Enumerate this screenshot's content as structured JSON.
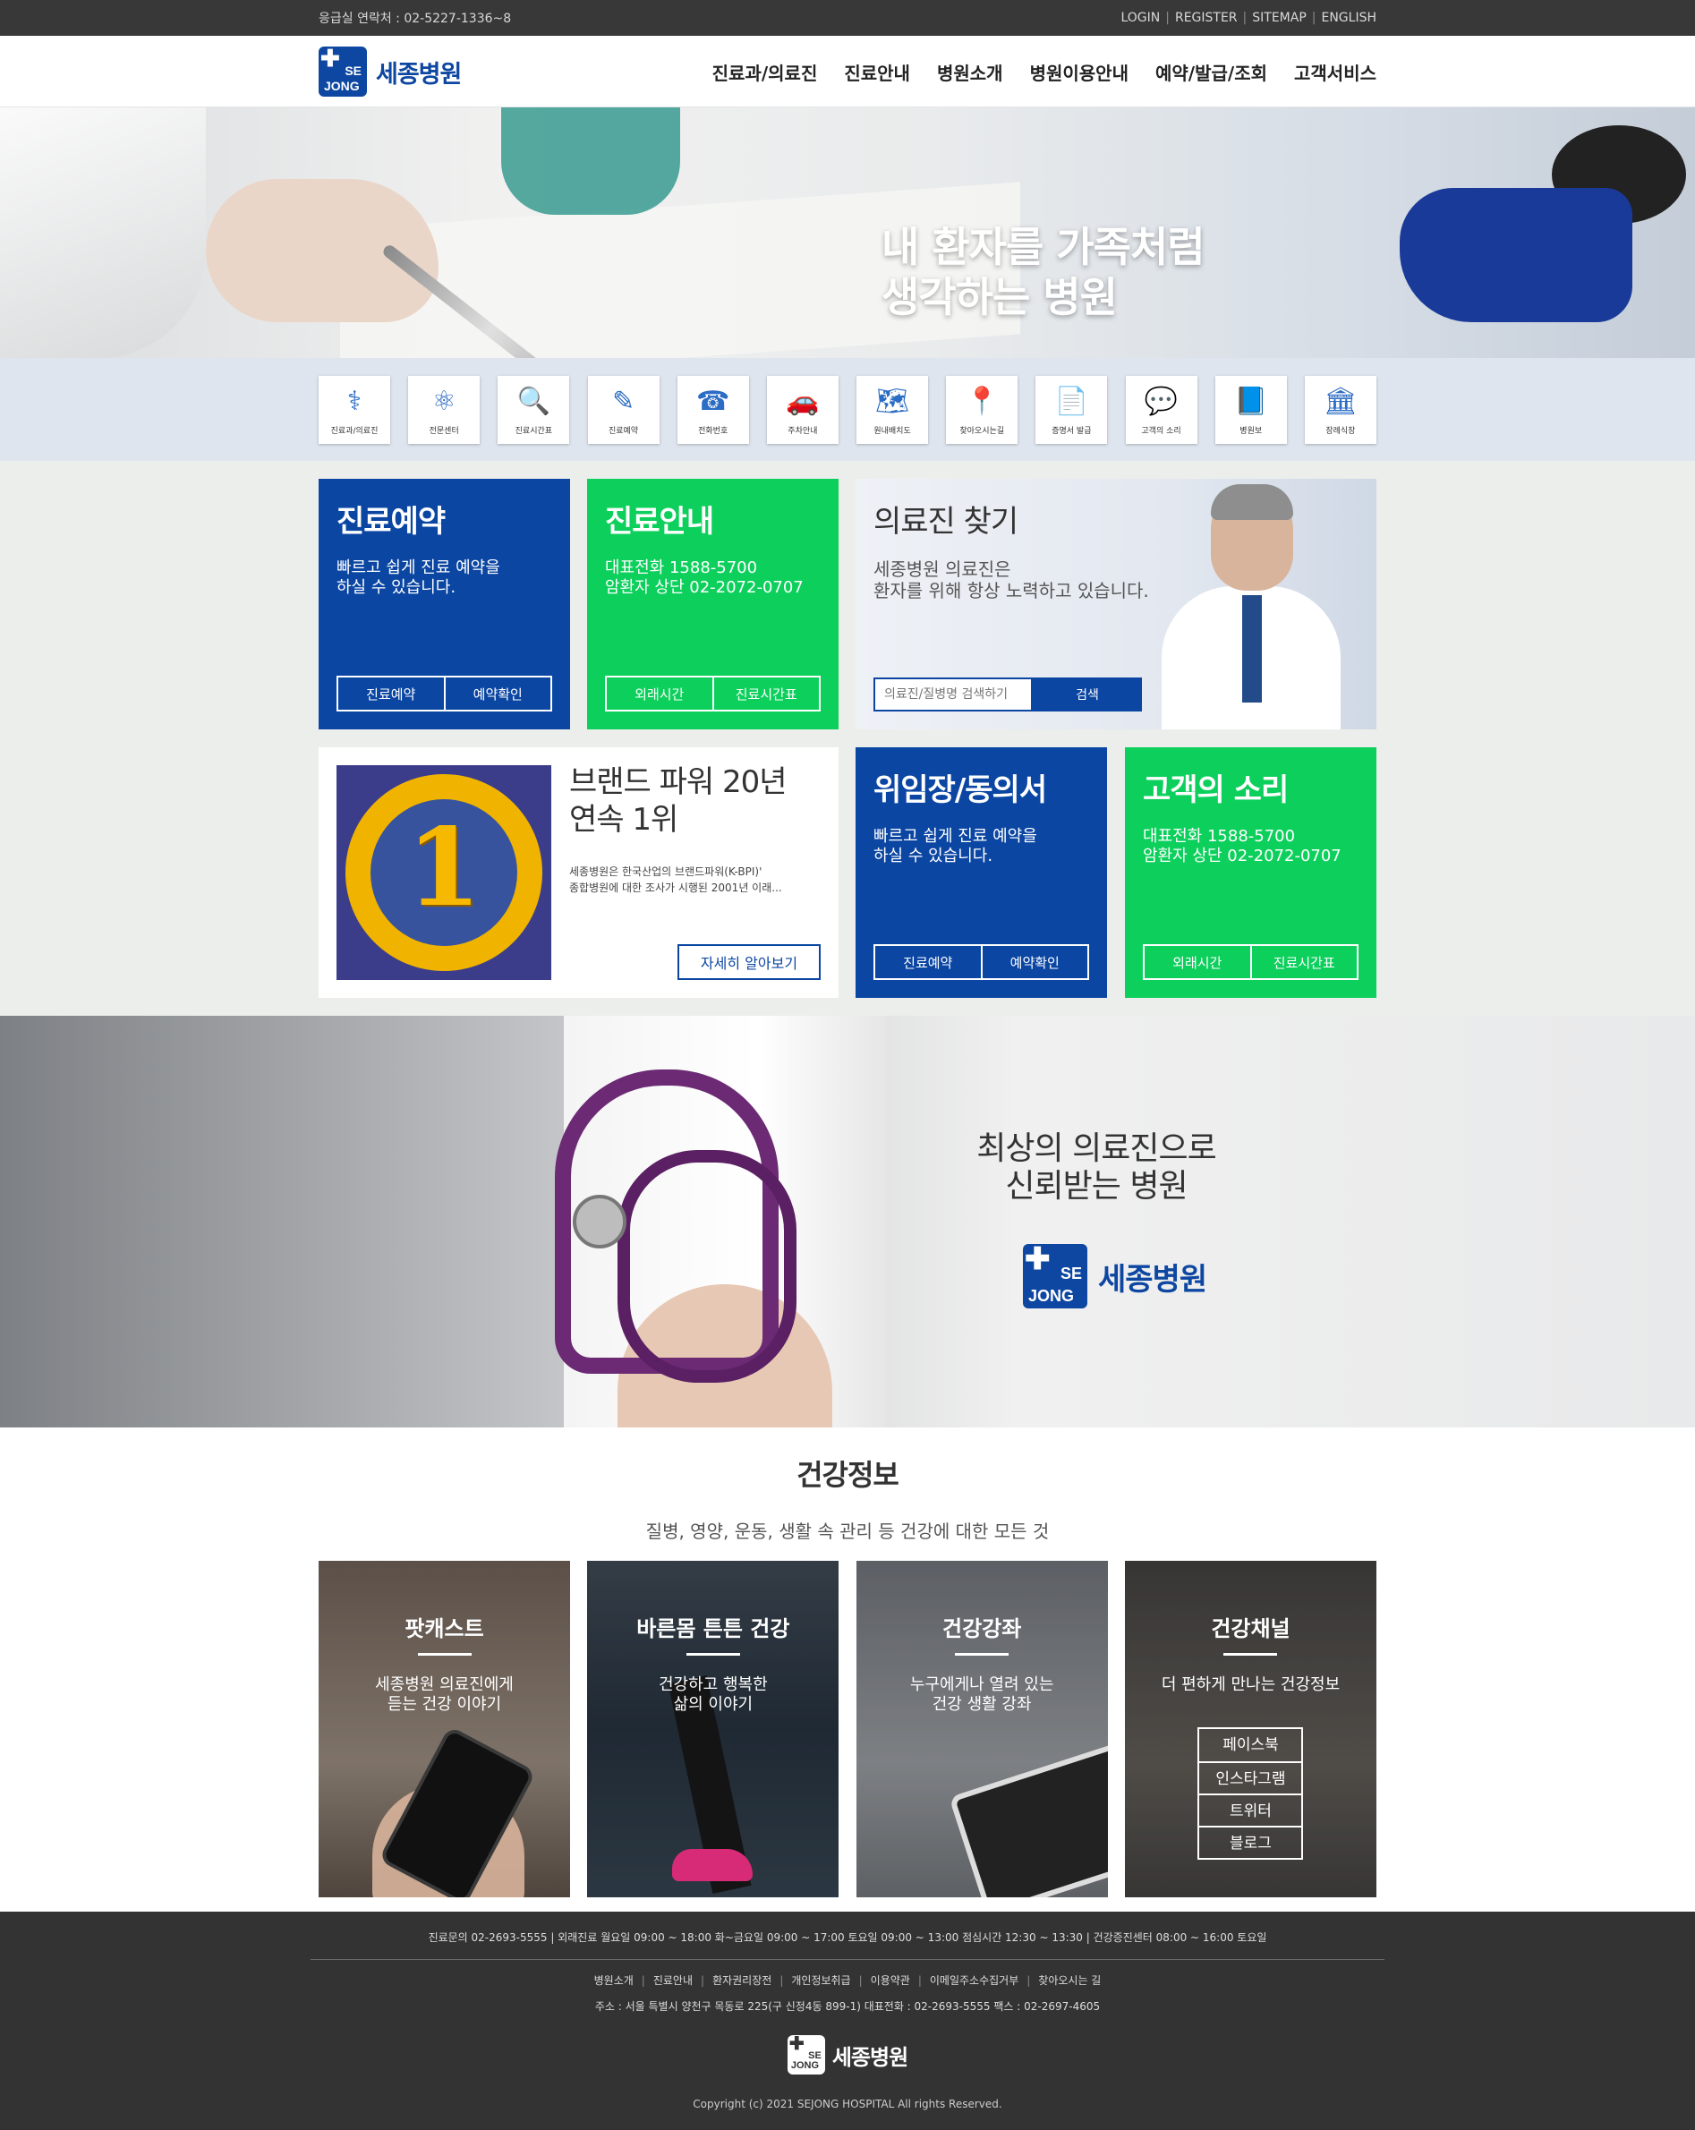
{
  "topbar": {
    "emergency": "응급실 연락처 : 02-5227-1336~8",
    "links": [
      "LOGIN",
      "REGISTER",
      "SITEMAP",
      "ENGLISH"
    ]
  },
  "header": {
    "logo_se": "SE",
    "logo_jong": "JONG",
    "logo_text": "세종병원",
    "nav": [
      "진료과/의료진",
      "진료안내",
      "병원소개",
      "병원이용안내",
      "예약/발급/조회",
      "고객서비스"
    ]
  },
  "hero": {
    "line1": "내 환자를 가족처럼",
    "line2": "생각하는 병원"
  },
  "quick_menu": [
    {
      "label": "진료과/의료진",
      "icon": "stethoscope-icon",
      "glyph": "⚕"
    },
    {
      "label": "전문센터",
      "icon": "molecule-icon",
      "glyph": "⚛"
    },
    {
      "label": "진료시간표",
      "icon": "magnifier-schedule-icon",
      "glyph": "🔍"
    },
    {
      "label": "진료예약",
      "icon": "reservation-icon",
      "glyph": "✎"
    },
    {
      "label": "전화번호",
      "icon": "phonebook-icon",
      "glyph": "☎"
    },
    {
      "label": "주차안내",
      "icon": "car-icon",
      "glyph": "🚗"
    },
    {
      "label": "원내배치도",
      "icon": "map-icon",
      "glyph": "🗺"
    },
    {
      "label": "찾아오시는길",
      "icon": "location-icon",
      "glyph": "📍"
    },
    {
      "label": "증명서 발급",
      "icon": "certificate-icon",
      "glyph": "📄"
    },
    {
      "label": "고객의 소리",
      "icon": "speech-icon",
      "glyph": "💬"
    },
    {
      "label": "병원보",
      "icon": "newsletter-icon",
      "glyph": "📘"
    },
    {
      "label": "장례식장",
      "icon": "building-icon",
      "glyph": "🏛"
    }
  ],
  "boxes": {
    "reserve": {
      "title": "진료예약",
      "desc1": "빠르고 쉽게 진료 예약을",
      "desc2": "하실 수 있습니다.",
      "btn1": "진료예약",
      "btn2": "예약확인"
    },
    "guide": {
      "title": "진료안내",
      "desc1": "대표전화 1588-5700",
      "desc2": "암환자 상단 02-2072-0707",
      "btn1": "외래시간",
      "btn2": "진료시간표"
    },
    "doctor": {
      "title": "의료진 찾기",
      "desc1": "세종병원 의료진은",
      "desc2": "환자를 위해 항상 노력하고 있습니다.",
      "search_placeholder": "의료진/질병명 검색하기",
      "search_btn": "검색"
    },
    "brand": {
      "title1": "브랜드 파워 20년",
      "title2": "연속 1위",
      "desc1": "세종병원은 한국산업의 브랜드파워(K-BPI)'",
      "desc2": "종합병원에 대한 조사가 시행된 2001년 이래...",
      "more": "자세히 알아보기",
      "badge_num": "1"
    },
    "consent": {
      "title": "위임장/동의서",
      "desc1": "빠르고 쉽게 진료 예약을",
      "desc2": "하실 수 있습니다.",
      "btn1": "진료예약",
      "btn2": "예약확인"
    },
    "voice": {
      "title": "고객의 소리",
      "desc1": "대표전화 1588-5700",
      "desc2": "암환자 상단 02-2072-0707",
      "btn1": "외래시간",
      "btn2": "진료시간표"
    }
  },
  "promo": {
    "line1": "최상의 의료진으로",
    "line2": "신뢰받는 병원"
  },
  "health": {
    "title": "건강정보",
    "subtitle": "질병, 영양, 운동, 생활 속 관리 등 건강에 대한 모든 것",
    "cards": [
      {
        "title": "팟캐스트",
        "desc1": "세종병원 의료진에게",
        "desc2": "듣는 건강 이야기"
      },
      {
        "title": "바른몸 튼튼 건강",
        "desc1": "건강하고 행복한",
        "desc2": "삶의 이야기"
      },
      {
        "title": "건강강좌",
        "desc1": "누구에게나 열려 있는",
        "desc2": "건강 생활 강좌"
      },
      {
        "title": "건강채널",
        "desc1": "더 편하게 만나는 건강정보",
        "desc2": ""
      }
    ],
    "sns": [
      "페이스북",
      "인스타그램",
      "트위터",
      "블로그"
    ]
  },
  "footer": {
    "info": "진료문의 02-2693-5555  |  외래진료 월요일 09:00 ~ 18:00 화~금요일 09:00 ~ 17:00 토요일 09:00 ~ 13:00 점심시간 12:30 ~ 13:30  |  건강증진센터 08:00 ~ 16:00 토요일",
    "links": [
      "병원소개",
      "진료안내",
      "환자권리장전",
      "개인정보취급",
      "이용약관",
      "이메일주소수집거부",
      "찾아오시는 길"
    ],
    "address": "주소 : 서울 특별시 양천구 목동로 225(구 신정4동 899-1) 대표전화 : 02-2693-5555 팩스 : 02-2697-4605",
    "copyright": "Copyright (c) 2021 SEJONG HOSPITAL All rights Reserved."
  }
}
